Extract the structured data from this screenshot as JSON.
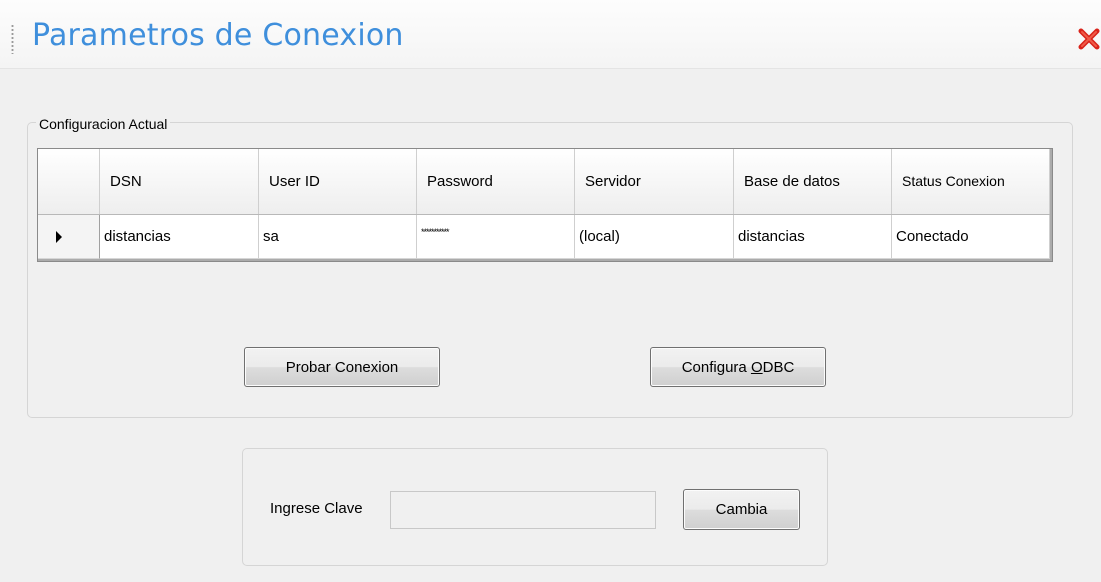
{
  "window": {
    "title": "Parametros de Conexion",
    "close_icon": "close-x-icon",
    "accent_color": "#3f8fdc",
    "close_color": "#d9231a"
  },
  "config_group": {
    "legend": "Configuracion Actual",
    "columns": [
      "DSN",
      "User ID",
      "Password",
      "Servidor",
      "Base de datos",
      "Status Conexion"
    ],
    "rows": [
      {
        "indicator": "current-row-arrow",
        "dsn": "distancias",
        "user_id": "sa",
        "password": "***********",
        "servidor": "(local)",
        "base_de_datos": "distancias",
        "status": "Conectado"
      }
    ],
    "buttons": {
      "probar_label": "Probar Conexion",
      "odbc_label_prefix": "Configura ",
      "odbc_label_mnemonic": "O",
      "odbc_label_suffix": "DBC"
    }
  },
  "password_panel": {
    "label": "Ingrese Clave",
    "value": "",
    "placeholder": "",
    "button_label": "Cambia"
  }
}
